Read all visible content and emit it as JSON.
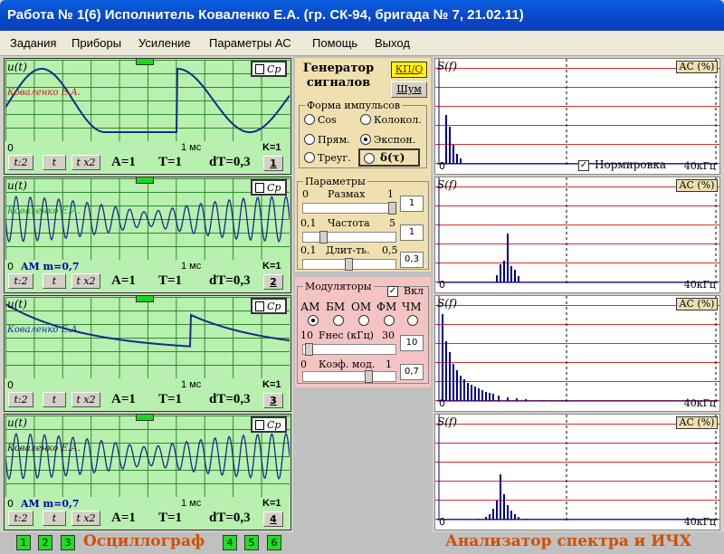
{
  "title": "Работа № 1(6)  Исполнитель Коваленко Е.А. (гр. СК-94, бригада № 7, 21.02.11)",
  "menu": [
    "Задания",
    "Приборы",
    "Усиление",
    "Параметры АС",
    "Помощь",
    "Выход"
  ],
  "osc_panels": [
    {
      "ylabel": "u(t)",
      "author": "Коваленко Е.А.",
      "author_color": "#c02020",
      "am": "",
      "zero": "0",
      "time": "1 мс",
      "k": "K=1",
      "btn_t2": "t:2",
      "btn_t": "t",
      "btn_tx2": "t x2",
      "A": "A=1",
      "T": "T=1",
      "dT": "dT=0,3",
      "num": "1",
      "cp": "Cp"
    },
    {
      "ylabel": "u(t)",
      "author": "Коваленко Е.А.",
      "author_color": "#20a020",
      "am": "AM m=0,7",
      "zero": "0",
      "time": "1 мс",
      "k": "K=1",
      "btn_t2": "t:2",
      "btn_t": "t",
      "btn_tx2": "t x2",
      "A": "A=1",
      "T": "T=1",
      "dT": "dT=0,3",
      "num": "2",
      "cp": "Cp"
    },
    {
      "ylabel": "u(t)",
      "author": "Коваленко Е.А.",
      "author_color": "#2020c0",
      "am": "",
      "zero": "0",
      "time": "1 мс",
      "k": "K=1",
      "btn_t2": "t:2",
      "btn_t": "t",
      "btn_tx2": "t x2",
      "A": "A=1",
      "T": "T=1",
      "dT": "dT=0,3",
      "num": "3",
      "cp": "Cp"
    },
    {
      "ylabel": "u(t)",
      "author": "Коваленко Е.А.",
      "author_color": "#202020",
      "am": "AM m=0,7",
      "zero": "0",
      "time": "1 мс",
      "k": "K=1",
      "btn_t2": "t:2",
      "btn_t": "t",
      "btn_tx2": "t x2",
      "A": "A=1",
      "T": "T=1",
      "dT": "dT=0,3",
      "num": "4",
      "cp": "Cp"
    }
  ],
  "generator": {
    "title_line1": "Генератор",
    "title_line2": "сигналов",
    "kpq": "КП/Q",
    "noise": "Шум",
    "pulse_form_legend": "Форма импульсов",
    "pulse_forms": [
      {
        "label": "Cos",
        "selected": false
      },
      {
        "label": "Колокол.",
        "selected": false
      },
      {
        "label": "Прям.",
        "selected": false
      },
      {
        "label": "Экспон.",
        "selected": true
      },
      {
        "label": "Треуг.",
        "selected": false
      }
    ],
    "delta": "δ(τ)",
    "params_legend": "Параметры",
    "params": [
      {
        "min": "0",
        "label": "Размах",
        "max": "1",
        "value": "1"
      },
      {
        "min": "0,1",
        "label": "Частота",
        "max": "5",
        "value": "1"
      },
      {
        "min": "0,1",
        "label": "Длит-ть.",
        "max": "0,5",
        "value": "0,3"
      }
    ]
  },
  "modulators": {
    "legend": "Модуляторы",
    "enable_label": "Вкл",
    "enabled": true,
    "types": [
      {
        "label": "АМ",
        "selected": true
      },
      {
        "label": "БМ",
        "selected": false
      },
      {
        "label": "ОМ",
        "selected": false
      },
      {
        "label": "ФМ",
        "selected": false
      },
      {
        "label": "ЧМ",
        "selected": false
      }
    ],
    "fnes_min": "10",
    "fnes_label": "Fнес (кГц)",
    "fnes_max": "30",
    "fnes_value": "10",
    "kmod_min": "0",
    "kmod_label": "Коэф. мод.",
    "kmod_max": "1",
    "kmod_value": "0,7"
  },
  "spec_panels": [
    {
      "ylabel": "S(f)",
      "ac": "AC (%)",
      "zero": "0",
      "fmax": "40кГц",
      "normalize_label": "Нормировка",
      "normalize": true
    },
    {
      "ylabel": "S(f)",
      "ac": "AC (%)",
      "zero": "0",
      "fmax": "40кГц"
    },
    {
      "ylabel": "S(f)",
      "ac": "AC (%)",
      "zero": "0",
      "fmax": "40кГц"
    },
    {
      "ylabel": "S(f)",
      "ac": "AC (%)",
      "zero": "0",
      "fmax": "40кГц"
    }
  ],
  "bottom": {
    "left_nums": [
      "1",
      "2",
      "3"
    ],
    "osc_label": "Осциллограф",
    "right_nums": [
      "4",
      "5",
      "6"
    ],
    "spec_label": "Анализатор спектра и ИЧХ"
  }
}
